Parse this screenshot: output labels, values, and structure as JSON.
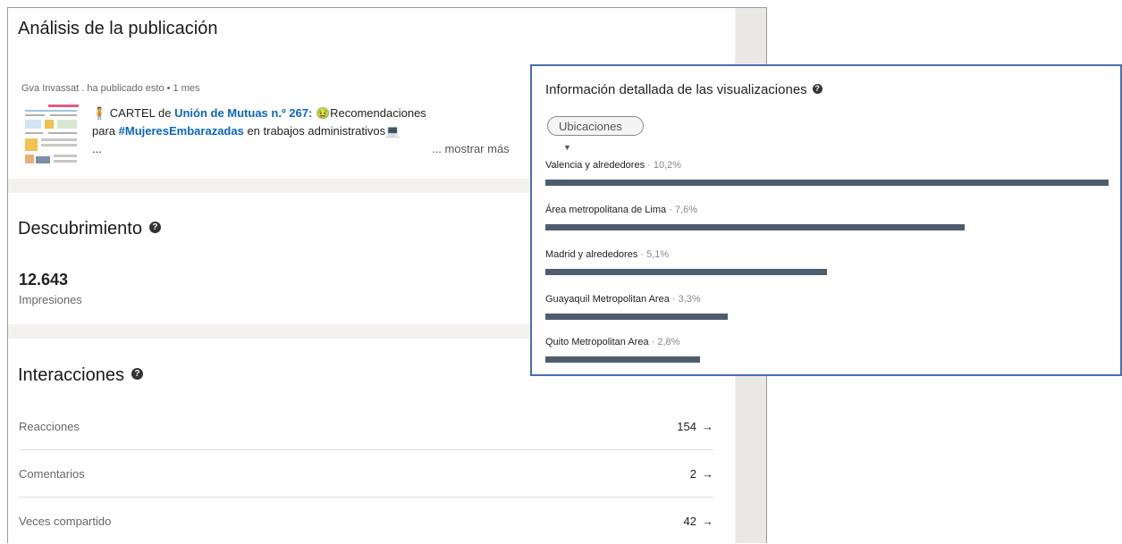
{
  "post_analysis": {
    "title": "Análisis de la publicación",
    "author_meta": "Gva Invassat . ha publicado esto • 1 mes",
    "post_line1_prefix": "🧍 CARTEL de ",
    "post_line1_link": "Unión de Mutuas n.º 267:",
    "post_line1_suffix": " 🤢Recomendaciones",
    "post_line2_prefix": "para ",
    "post_line2_link": "#MujeresEmbarazadas",
    "post_line2_suffix": " en trabajos administrativos💻",
    "post_line3": "...",
    "show_more": "... mostrar más"
  },
  "discovery": {
    "title": "Descubrimiento",
    "impressions_value": "12.643",
    "impressions_label": "Impresiones"
  },
  "interactions": {
    "title": "Interacciones",
    "rows": [
      {
        "label": "Reacciones",
        "value": "154",
        "arrow": "→"
      },
      {
        "label": "Comentarios",
        "value": "2",
        "arrow": "→"
      },
      {
        "label": "Veces compartido",
        "value": "42",
        "arrow": "→"
      }
    ]
  },
  "views_detail": {
    "title": "Información detallada de las visualizaciones",
    "filter_label": "Ubicaciones",
    "bar_color": "#4e5d6e",
    "locations": [
      {
        "name": "Valencia y alrededores",
        "percent_label": " · 10,2%",
        "share": 10.2
      },
      {
        "name": "Área metropolitana de Lima",
        "percent_label": " · 7,6%",
        "share": 7.6
      },
      {
        "name": "Madrid y alrededores",
        "percent_label": " · 5,1%",
        "share": 5.1
      },
      {
        "name": "Guayaquil Metropolitan Area",
        "percent_label": " · 3,3%",
        "share": 3.3
      },
      {
        "name": "Quito Metropolitan Area",
        "percent_label": " · 2,8%",
        "share": 2.8
      }
    ]
  }
}
